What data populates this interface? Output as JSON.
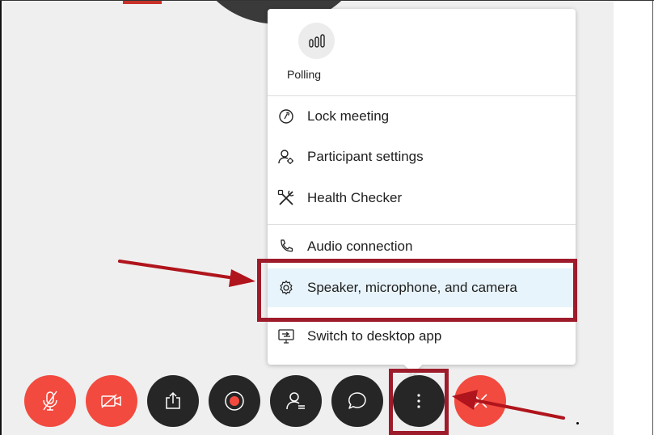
{
  "menu": {
    "polling_label": "Polling",
    "items": [
      {
        "label": "Lock meeting",
        "icon": "lock-meeting-icon"
      },
      {
        "label": "Participant settings",
        "icon": "participant-settings-icon"
      },
      {
        "label": "Health Checker",
        "icon": "health-checker-icon"
      },
      {
        "label": "Audio connection",
        "icon": "phone-icon"
      },
      {
        "label": "Speaker, microphone, and camera",
        "icon": "gear-icon"
      },
      {
        "label": "Switch to desktop app",
        "icon": "desktop-app-icon"
      }
    ]
  },
  "toolbar": {
    "buttons": [
      {
        "name": "mute-button",
        "icon": "microphone-muted-icon"
      },
      {
        "name": "video-button",
        "icon": "video-off-icon"
      },
      {
        "name": "share-button",
        "icon": "share-icon"
      },
      {
        "name": "record-button",
        "icon": "record-icon"
      },
      {
        "name": "participants-button",
        "icon": "participants-icon"
      },
      {
        "name": "chat-button",
        "icon": "chat-icon"
      },
      {
        "name": "more-options-button",
        "icon": "more-options-icon"
      },
      {
        "name": "leave-button",
        "icon": "close-icon"
      }
    ]
  },
  "colors": {
    "highlight": "#9e1b2b",
    "red_button": "#f24a3f",
    "dark_button": "#262626",
    "active_row": "#e8f4fb"
  }
}
